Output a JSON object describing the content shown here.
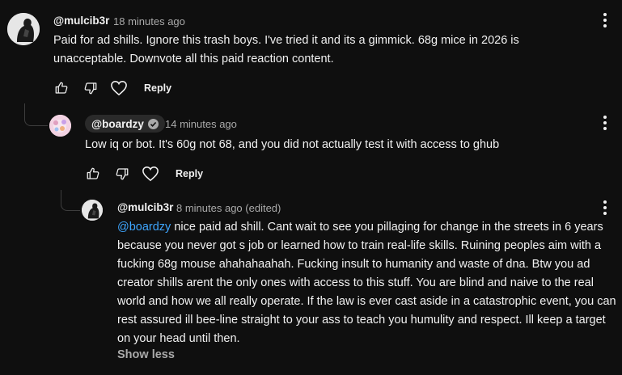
{
  "comments": [
    {
      "author": "@mulcib3r",
      "time": "18 minutes ago",
      "body": "Paid for ad shills. Ignore this trash boys. I've tried it and its a gimmick. 68g mice in 2026 is unacceptable. Downvote all this paid reaction content.",
      "reply_label": "Reply"
    },
    {
      "author": "@boardzy",
      "verified": true,
      "time": "14 minutes ago",
      "body": "Low iq or bot. It's 60g not 68, and you did not actually test it with access to ghub",
      "reply_label": "Reply"
    },
    {
      "author": "@mulcib3r",
      "time": "8 minutes ago (edited)",
      "mention": "@boardzy",
      "body": " nice paid ad shill. Cant wait to see you pillaging for change in the streets in 6 years because you never got s job or learned how to train real-life skills. Ruining peoples aim with a fucking 68g mouse ahahahaahah. Fucking insult to humanity and waste of dna. Btw you ad creator shills arent the only ones with access to this stuff. You are blind and naive to the real world and how we all really operate. If the law is ever cast aside in a catastrophic event, you can rest assured ill bee-line straight to your ass to teach you humulity and respect. Ill keep a target on your head until then.",
      "show_less": "Show less"
    }
  ]
}
